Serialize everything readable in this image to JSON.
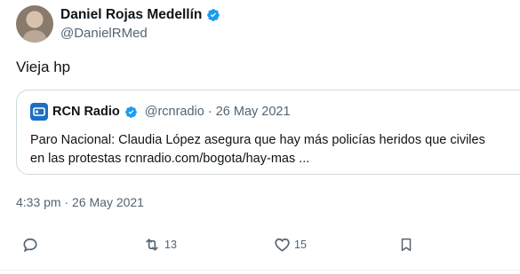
{
  "author": {
    "name": "Daniel Rojas Medellín",
    "handle": "@DanielRMed"
  },
  "tweet": {
    "text": "Vieja hp",
    "timestamp": "4:33 pm · 26 May 2021"
  },
  "quoted": {
    "name": "RCN Radio",
    "meta": "@rcnradio · 26 May 2021",
    "line1": "Paro Nacional: Claudia López asegura que hay más policías heridos que civiles",
    "line2": "en las protestas rcnradio.com/bogota/hay-mas ..."
  },
  "actions": {
    "retweets": "13",
    "likes": "15"
  },
  "colors": {
    "verified": "#1d9bf0",
    "secondary_text": "#536471",
    "border": "#cfd9de"
  }
}
